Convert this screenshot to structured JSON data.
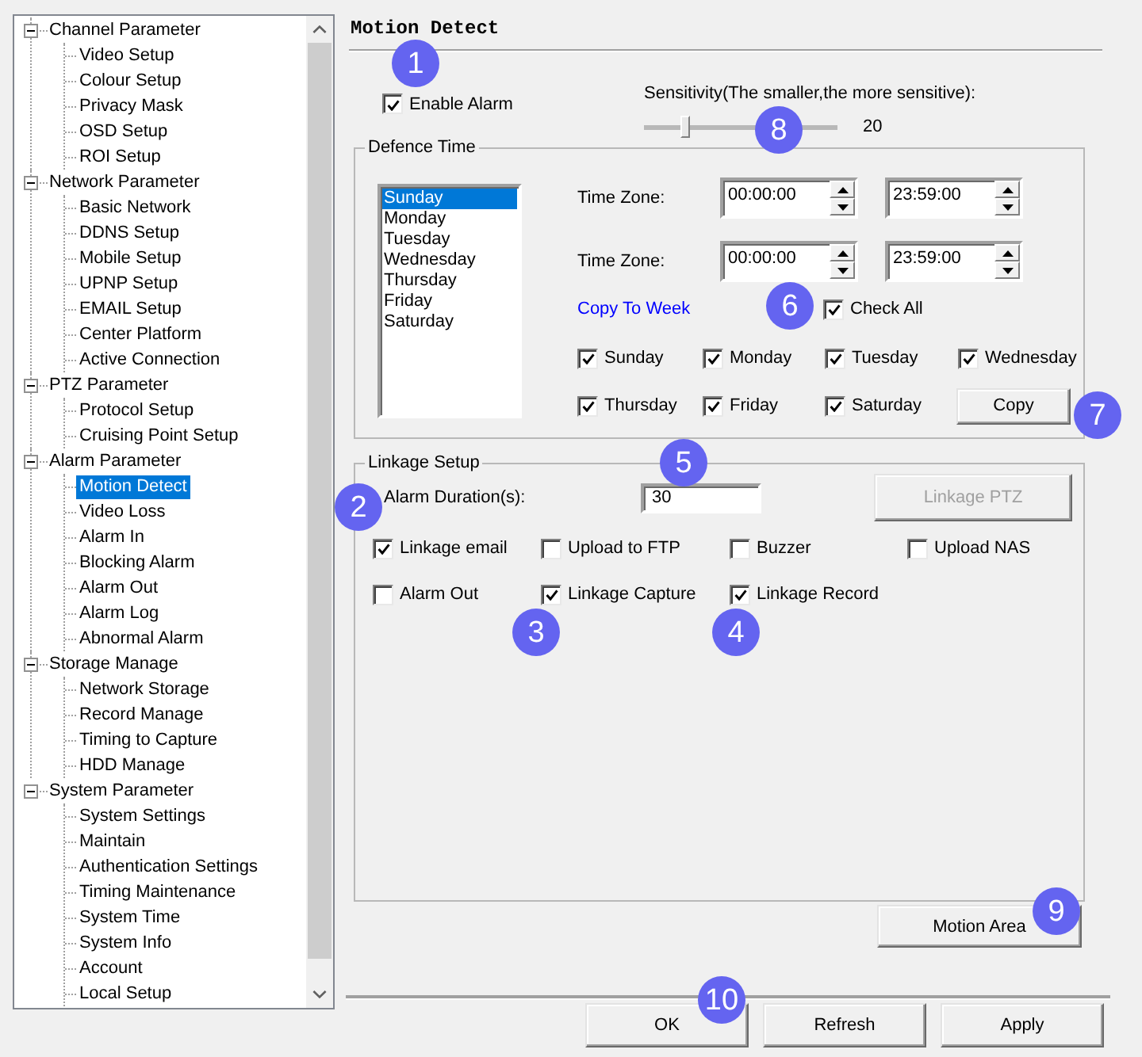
{
  "sidebar": {
    "items": [
      {
        "label": "Channel Parameter",
        "expanded": true,
        "selected": false,
        "children": [
          {
            "label": "Video Setup",
            "selected": false
          },
          {
            "label": "Colour Setup",
            "selected": false
          },
          {
            "label": "Privacy Mask",
            "selected": false
          },
          {
            "label": "OSD Setup",
            "selected": false
          },
          {
            "label": "ROI Setup",
            "selected": false
          }
        ]
      },
      {
        "label": "Network Parameter",
        "expanded": true,
        "selected": false,
        "children": [
          {
            "label": "Basic Network",
            "selected": false
          },
          {
            "label": "DDNS Setup",
            "selected": false
          },
          {
            "label": "Mobile Setup",
            "selected": false
          },
          {
            "label": "UPNP Setup",
            "selected": false
          },
          {
            "label": "EMAIL Setup",
            "selected": false
          },
          {
            "label": "Center Platform",
            "selected": false
          },
          {
            "label": "Active Connection",
            "selected": false
          }
        ]
      },
      {
        "label": "PTZ Parameter",
        "expanded": true,
        "selected": false,
        "children": [
          {
            "label": "Protocol Setup",
            "selected": false
          },
          {
            "label": "Cruising Point Setup",
            "selected": false
          }
        ]
      },
      {
        "label": "Alarm Parameter",
        "expanded": true,
        "selected": false,
        "children": [
          {
            "label": "Motion Detect",
            "selected": true
          },
          {
            "label": "Video Loss",
            "selected": false
          },
          {
            "label": "Alarm In",
            "selected": false
          },
          {
            "label": "Blocking Alarm",
            "selected": false
          },
          {
            "label": "Alarm Out",
            "selected": false
          },
          {
            "label": "Alarm Log",
            "selected": false
          },
          {
            "label": "Abnormal Alarm",
            "selected": false
          }
        ]
      },
      {
        "label": "Storage Manage",
        "expanded": true,
        "selected": false,
        "children": [
          {
            "label": "Network Storage",
            "selected": false
          },
          {
            "label": "Record Manage",
            "selected": false
          },
          {
            "label": "Timing to Capture",
            "selected": false
          },
          {
            "label": "HDD Manage",
            "selected": false
          }
        ]
      },
      {
        "label": "System Parameter",
        "expanded": true,
        "selected": false,
        "children": [
          {
            "label": "System Settings",
            "selected": false
          },
          {
            "label": "Maintain",
            "selected": false
          },
          {
            "label": "Authentication Settings",
            "selected": false
          },
          {
            "label": "Timing Maintenance",
            "selected": false
          },
          {
            "label": "System Time",
            "selected": false
          },
          {
            "label": "System Info",
            "selected": false
          },
          {
            "label": "Account",
            "selected": false
          },
          {
            "label": "Local Setup",
            "selected": false
          }
        ]
      }
    ]
  },
  "title": "Motion Detect",
  "enable_alarm": {
    "label": "Enable Alarm",
    "checked": true
  },
  "sensitivity": {
    "label": "Sensitivity(The smaller,the more sensitive):",
    "level": 0.2,
    "reading": "20"
  },
  "defence_time": {
    "title": "Defence Time",
    "days": [
      {
        "label": "Sunday",
        "selected": true
      },
      {
        "label": "Monday",
        "selected": false
      },
      {
        "label": "Tuesday",
        "selected": false
      },
      {
        "label": "Wednesday",
        "selected": false
      },
      {
        "label": "Thursday",
        "selected": false
      },
      {
        "label": "Friday",
        "selected": false
      },
      {
        "label": "Saturday",
        "selected": false
      }
    ],
    "time_zones": [
      {
        "label": "Time Zone:",
        "start": "00:00:00",
        "end": "23:59:00"
      },
      {
        "label": "Time Zone:",
        "start": "00:00:00",
        "end": "23:59:00"
      }
    ],
    "copy_to_week": "Copy To Week",
    "check_all": {
      "label": "Check All",
      "checked": true
    },
    "copy_days": [
      {
        "label": "Sunday",
        "checked": true
      },
      {
        "label": "Monday",
        "checked": true
      },
      {
        "label": "Tuesday",
        "checked": true
      },
      {
        "label": "Wednesday",
        "checked": true
      },
      {
        "label": "Thursday",
        "checked": true
      },
      {
        "label": "Friday",
        "checked": true
      },
      {
        "label": "Saturday",
        "checked": true
      }
    ],
    "copy_button": "Copy"
  },
  "linkage": {
    "title": "Linkage Setup",
    "duration": {
      "label": "Alarm Duration(s):",
      "value": "30"
    },
    "ptz_button": {
      "label": "Linkage PTZ",
      "disabled": true
    },
    "options": [
      {
        "label": "Linkage email",
        "checked": true
      },
      {
        "label": "Upload to FTP",
        "checked": false
      },
      {
        "label": "Buzzer",
        "checked": false
      },
      {
        "label": "Upload NAS",
        "checked": false
      },
      {
        "label": "Alarm Out",
        "checked": false
      },
      {
        "label": "Linkage Capture",
        "checked": true
      },
      {
        "label": "Linkage Record",
        "checked": true
      }
    ]
  },
  "motion_area_button": "Motion Area",
  "buttons": [
    "OK",
    "Refresh",
    "Apply"
  ],
  "callouts": [
    "1",
    "2",
    "3",
    "4",
    "5",
    "6",
    "7",
    "8",
    "9",
    "10"
  ]
}
